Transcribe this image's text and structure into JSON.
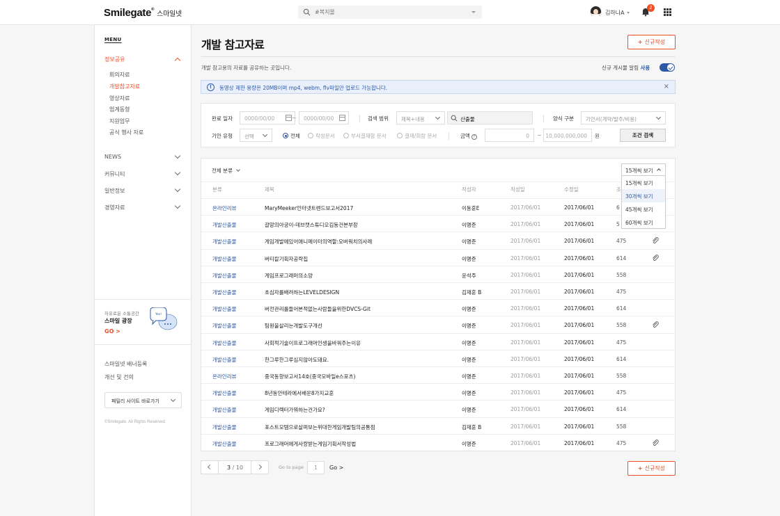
{
  "header": {
    "logo_text": "Smilegate",
    "logo_sup": "®",
    "logo_korean": "스마일넷",
    "search_placeholder": "#복지몰",
    "user_name": "김하나A",
    "notification_count": "2"
  },
  "sidebar": {
    "menu_label": "MENU",
    "sections": [
      {
        "label": "정보공유",
        "active": true
      },
      {
        "label": "NEWS"
      },
      {
        "label": "커뮤니티"
      },
      {
        "label": "일반정보"
      },
      {
        "label": "경영자료"
      }
    ],
    "sub_items": [
      {
        "label": "회의자료"
      },
      {
        "label": "개발참고자료",
        "active": true
      },
      {
        "label": "영상자료"
      },
      {
        "label": "업계동향"
      },
      {
        "label": "지원업무"
      },
      {
        "label": "공식 행사 자료"
      }
    ],
    "promo": {
      "small": "자유로운 소통공간",
      "title": "스마일 광장",
      "go": "GO >",
      "bubble": "Yes!"
    },
    "links": [
      "스마일넷 배너등록",
      "개선 및 건의"
    ],
    "family_site": "패밀리 사이트 바로가기",
    "copyright": "©Smilegate. All Rights Reserved."
  },
  "main": {
    "title": "개발 참고자료",
    "new_button": "신규작성",
    "description": "개발 참고용의 자료를 공유하는 곳입니다.",
    "notify_label": "신규 게시물 알림",
    "notify_state": "사용",
    "info_text": "동영상 제한 용량은 20MB이며 mp4, webm, flv파일만 업로드 가능합니다."
  },
  "filter": {
    "date_label": "완료 일자",
    "date_from": "0000/00/00",
    "date_to": "0000/00/00",
    "tilde": "~",
    "scope_label": "검색 범위",
    "scope_value": "제목+내용",
    "query": "산출물",
    "form_label": "양식 구분",
    "form_value": "기안서(계약/발주/비용)",
    "type_label": "기안 유형",
    "type_value": "선택",
    "radios": [
      {
        "label": "전체",
        "checked": true
      },
      {
        "label": "작성문서"
      },
      {
        "label": "부서결재함 문서"
      },
      {
        "label": "결재/회람 문서"
      }
    ],
    "amount_label": "금액",
    "amount_help": "?",
    "amount_from": "0",
    "amount_to": "10,000,000,000",
    "amount_unit": "원",
    "search_button": "조건 검색"
  },
  "table": {
    "category_filter": "전체 분류",
    "columns": [
      "분류",
      "제목",
      "작성자",
      "작성일",
      "수정일",
      "조"
    ],
    "page_size": {
      "current": "15개씩 보기",
      "options": [
        "15개씩 보기",
        "30개씩 보기",
        "45개씩 보기",
        "60개씩 보기"
      ],
      "highlighted": 1
    },
    "rows": [
      {
        "category": "온라인리뷰",
        "title": "MaryMeeker인터넷트렌드보고서2017",
        "author": "이동훈E",
        "created": "2017/06/01",
        "modified": "2017/06/01",
        "views": "6",
        "attachment": false
      },
      {
        "category": "개발산출물",
        "title": "갈망의아궁이-데브캣스튜디오김동건본부장",
        "author": "이명준",
        "created": "2017/06/01",
        "modified": "2017/06/01",
        "views": "5",
        "attachment": false
      },
      {
        "category": "개발산출물",
        "title": "게임개발에있어애니메이터의역할:오버워치의사례",
        "author": "이명준",
        "created": "2017/06/01",
        "modified": "2017/06/01",
        "views": "475",
        "attachment": true
      },
      {
        "category": "개발산출물",
        "title": "버티칼기획자공략집",
        "author": "이명준",
        "created": "2017/06/01",
        "modified": "2017/06/01",
        "views": "614",
        "attachment": true
      },
      {
        "category": "개발산출물",
        "title": "게임프로그래머의소양",
        "author": "윤석주",
        "created": "2017/06/01",
        "modified": "2017/06/01",
        "views": "558",
        "attachment": false
      },
      {
        "category": "개발산출물",
        "title": "초심자를배려하는LEVELDESIGN",
        "author": "김재훈 B",
        "created": "2017/06/01",
        "modified": "2017/06/01",
        "views": "475",
        "attachment": false
      },
      {
        "category": "개발산출물",
        "title": "버전관리를들어본적없는사람들을위한DVCS-Git",
        "author": "이명준",
        "created": "2017/06/01",
        "modified": "2017/06/01",
        "views": "614",
        "attachment": false
      },
      {
        "category": "개발산출물",
        "title": "팀원을살리는개발도구개선",
        "author": "이명준",
        "created": "2017/06/01",
        "modified": "2017/06/01",
        "views": "558",
        "attachment": true
      },
      {
        "category": "개발산출물",
        "title": "사회적기술이프로그래머인생을바꿔주는이유",
        "author": "이명준",
        "created": "2017/06/01",
        "modified": "2017/06/01",
        "views": "475",
        "attachment": false
      },
      {
        "category": "개발산출물",
        "title": "한그루한그루심지않아도돼요.",
        "author": "이명준",
        "created": "2017/06/01",
        "modified": "2017/06/01",
        "views": "614",
        "attachment": false
      },
      {
        "category": "온라인리뷰",
        "title": "중국동향보고서14호(중국모바일e스포츠)",
        "author": "이명준",
        "created": "2017/06/01",
        "modified": "2017/06/01",
        "views": "558",
        "attachment": false
      },
      {
        "category": "개발산출물",
        "title": "8년동안테라에서배운8가지교훈",
        "author": "이명준",
        "created": "2017/06/01",
        "modified": "2017/06/01",
        "views": "475",
        "attachment": false
      },
      {
        "category": "개발산출물",
        "title": "게임디렉터가뭐하는건가요?",
        "author": "이명준",
        "created": "2017/06/01",
        "modified": "2017/06/01",
        "views": "614",
        "attachment": false
      },
      {
        "category": "개발산출물",
        "title": " 포스트모템으로살펴보는위대한게임개발팀의공통점",
        "author": "김재훈 B",
        "created": "2017/06/01",
        "modified": "2017/06/01",
        "views": "558",
        "attachment": false
      },
      {
        "category": "개발산출물",
        "title": "프로그래머에게사랑받는게임기획서작성법",
        "author": "이명준",
        "created": "2017/06/01",
        "modified": "2017/06/01",
        "views": "475",
        "attachment": true
      }
    ]
  },
  "pagination": {
    "current": "3",
    "total": "/ 10",
    "goto_label": "Go to page",
    "goto_value": "1",
    "goto_button": "Go >"
  }
}
